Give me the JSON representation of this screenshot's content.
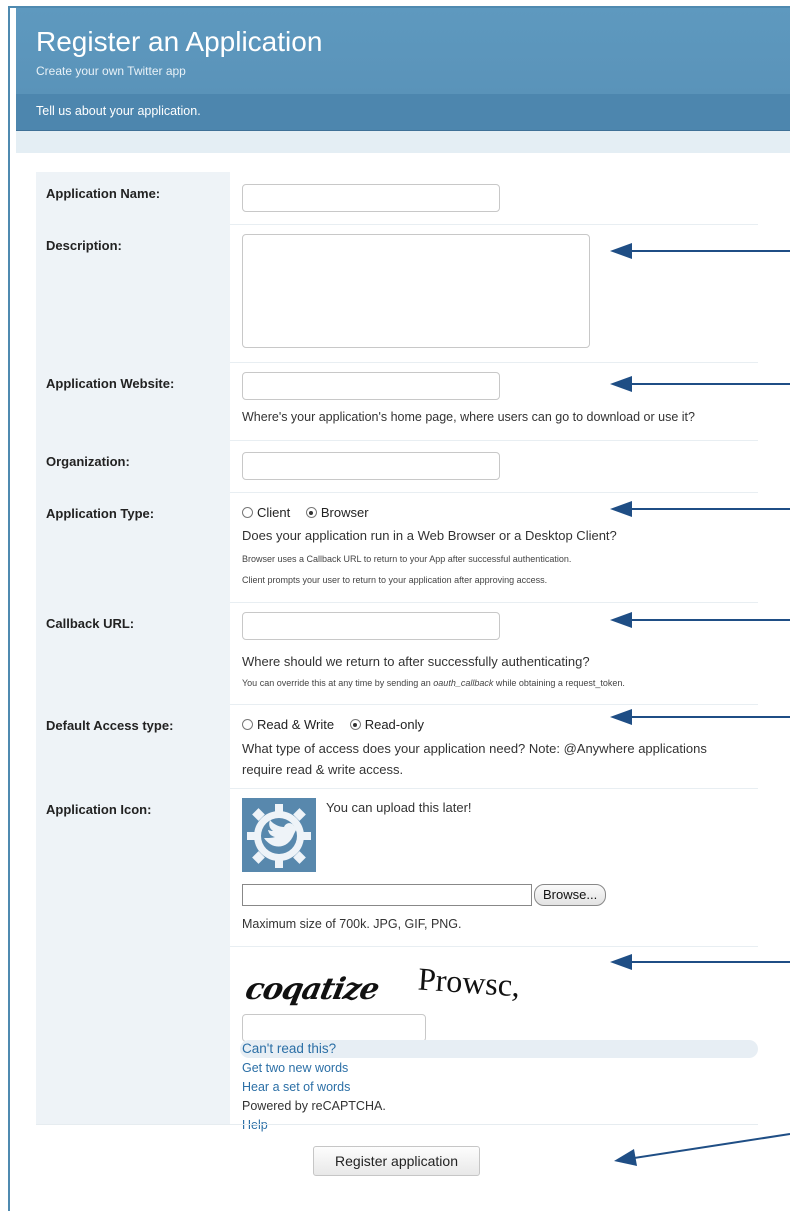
{
  "header": {
    "title": "Register an Application",
    "subtitle": "Create your own Twitter app"
  },
  "subbar": {
    "text": "Tell us about your application."
  },
  "fields": {
    "app_name": {
      "label": "Application Name:",
      "value": ""
    },
    "description": {
      "label": "Description:",
      "value": ""
    },
    "website": {
      "label": "Application Website:",
      "value": "",
      "hint": "Where's your application's home page, where users can go to download or use it?"
    },
    "organization": {
      "label": "Organization:",
      "value": ""
    },
    "app_type": {
      "label": "Application Type:",
      "options": [
        "Client",
        "Browser"
      ],
      "selected": "Browser",
      "hint": "Does your application run in a Web Browser or a Desktop Client?",
      "note1": "Browser uses a Callback URL to return to your App after successful authentication.",
      "note2": "Client prompts your user to return to your application after approving access."
    },
    "callback": {
      "label": "Callback URL:",
      "value": "",
      "hint": "Where should we return to after successfully authenticating?",
      "note_pre": "You can override this at any time by sending an ",
      "note_em": "oauth_callback",
      "note_post": " while obtaining a request_token."
    },
    "access": {
      "label": "Default Access type:",
      "options": [
        "Read & Write",
        "Read-only"
      ],
      "selected": "Read-only",
      "hint1": "What type of access does your application need? Note: @Anywhere applications",
      "hint2": "require read & write access."
    },
    "icon": {
      "label": "Application Icon:",
      "upload_later": "You can upload this later!",
      "browse_label": "Browse...",
      "size_hint": "Maximum size of 700k. JPG, GIF, PNG."
    }
  },
  "captcha": {
    "word1": "coqatize",
    "word2": "Prowsc,",
    "cant_read": "Can't read this?",
    "new_words": "Get two new words",
    "hear": "Hear a set of words",
    "powered": "Powered by reCAPTCHA.",
    "help": "Help"
  },
  "submit_label": "Register application",
  "colors": {
    "header_bg": "#5e99bf",
    "subbar_bg": "#4d86ae",
    "label_bg": "#eef3f7",
    "link": "#2b6fa6",
    "arrow": "#1f4e85"
  }
}
